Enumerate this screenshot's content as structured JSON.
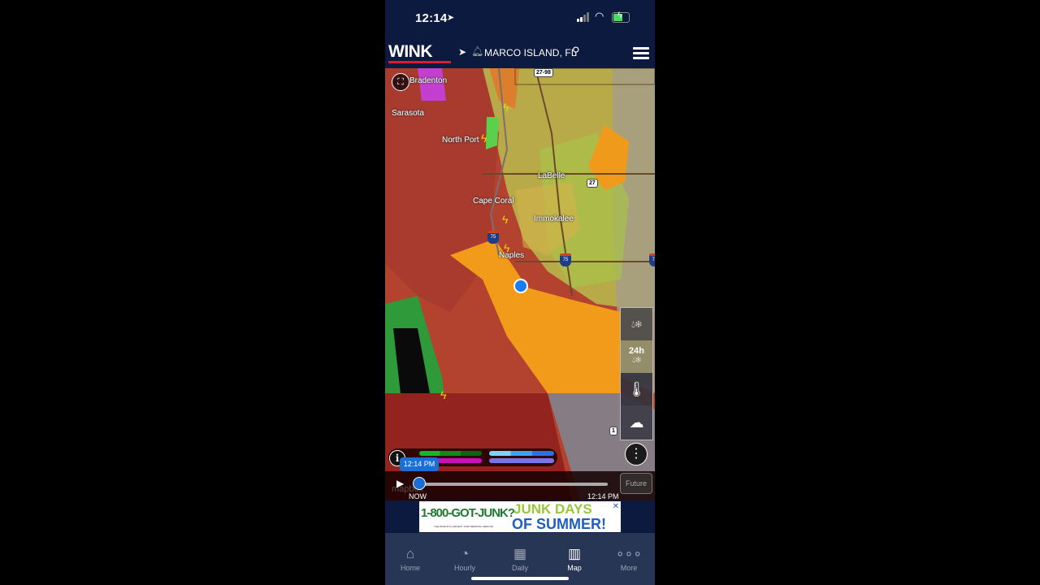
{
  "status_bar": {
    "time": "12:14",
    "location_icon": "location-arrow-icon",
    "battery": "charging"
  },
  "header": {
    "logo": "WINK",
    "location": "MARCO ISLAND, FL",
    "icons": [
      "location-arrow-icon",
      "bell-icon",
      "search-icon",
      "menu-icon"
    ]
  },
  "map": {
    "places": [
      "Bradenton",
      "Sarasota",
      "North Port",
      "Cape Coral",
      "LaBelle",
      "Immokalee",
      "Naples"
    ],
    "shields": {
      "us_27_98": "27-98",
      "us_27": "27",
      "i75_a": "75",
      "i75_b": "75",
      "i75_c": "75",
      "us_1": "1"
    },
    "attribution": "mapbox",
    "layers": [
      {
        "name": "precipitation-type",
        "label": ""
      },
      {
        "name": "24h-precip",
        "label": "24h"
      },
      {
        "name": "temperature",
        "label": ""
      },
      {
        "name": "clouds",
        "label": ""
      }
    ]
  },
  "legend": {
    "rain_colors": [
      "#17b52a",
      "#0e8a1e",
      "#0a6614"
    ],
    "mix_color": "#c612b8",
    "snow_colors": [
      "#7fd3f7",
      "#3aa4f0",
      "#2b6fe8"
    ],
    "ice_color": "#7c73e6"
  },
  "timeline": {
    "current_time": "12:14 PM",
    "start_label": "NOW",
    "end_label": "12:14 PM",
    "future_label": "Future",
    "progress": 0
  },
  "ad": {
    "brand": "1-800-GOT-JUNK?",
    "tagline": "THE WORLD'S LARGEST JUNK REMOVAL SERVICE",
    "headline1": "JUNK DAYS",
    "headline2": "OF SUMMER!"
  },
  "nav": [
    {
      "label": "Home",
      "icon": "home-icon",
      "active": false
    },
    {
      "label": "Hourly",
      "icon": "clock-icon",
      "active": false
    },
    {
      "label": "Daily",
      "icon": "calendar-icon",
      "active": false
    },
    {
      "label": "Map",
      "icon": "map-icon",
      "active": true
    },
    {
      "label": "More",
      "icon": "more-icon",
      "active": false
    }
  ]
}
